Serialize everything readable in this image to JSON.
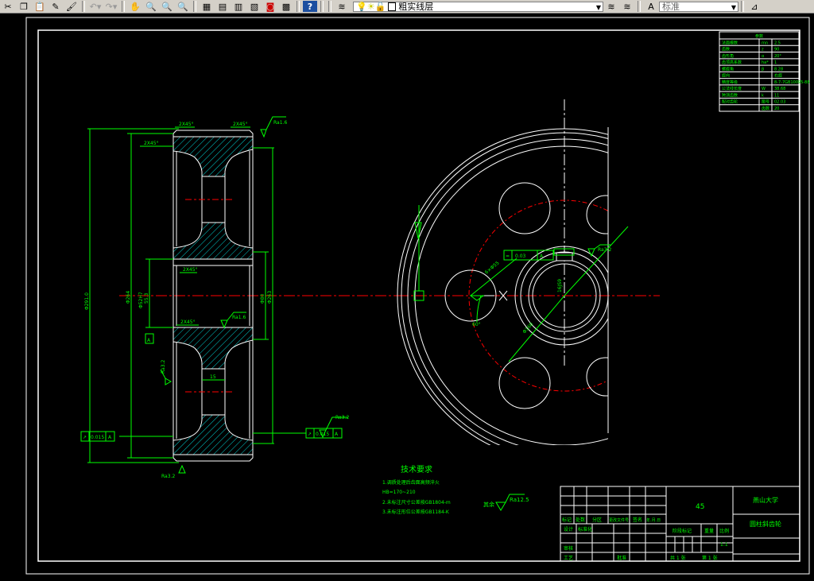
{
  "toolbar": {
    "icons": [
      "cut-icon",
      "copy-icon",
      "paste-icon",
      "match-properties-icon",
      "brush-icon",
      "undo-icon",
      "redo-icon",
      "pan-icon",
      "zoom-realtime-icon",
      "zoom-window-icon",
      "zoom-previous-icon",
      "properties-icon",
      "design-center-icon",
      "tool-palettes-icon",
      "sheet-set-icon",
      "markup-icon",
      "calculator-icon",
      "help-icon",
      "layer-manager-icon",
      "layer-state-icon",
      "layer-previous-icon",
      "text-style-icon",
      "dimension-style-icon"
    ],
    "layer_value": "粗实线层",
    "text_style_value": "标准",
    "help_label": "?"
  },
  "drawing": {
    "tech_req": {
      "title": "技术要求",
      "lines": [
        "1.调质处理后齿面高频淬火",
        "HB=170~210",
        "2.未标注尺寸公差按GB1804-m",
        "3.未标注形位公差按GB1184-K"
      ]
    },
    "other_roughness": "其余",
    "other_roughness_value": "Ra12.5",
    "left_view": {
      "chamfer_top_left": "2X45°",
      "chamfer_top_right": "2X45°",
      "chamfer_rim": "2X45°",
      "chamfer_bore_top": "2X45°",
      "chamfer_bore_bottom": "2X45°",
      "roughness_top": "Ra1.6",
      "roughness_bore": "Ra1.6",
      "roughness_bottom": "Ra3.2",
      "roughness_face": "Ra3.2",
      "roughness_side": "Ra3.2",
      "dim_tip": "Φ291.0",
      "dim_root": "Φ264",
      "dim_bore": "Φ52H7",
      "dim_keyway": "55.3",
      "dim_hub1": "Φ80",
      "dim_hub2": "Φ263",
      "dim_web": "15",
      "datum": "A",
      "tol_left": [
        "↗",
        "0.015",
        "A"
      ],
      "tol_right": [
        "↗",
        "0.015",
        "A"
      ]
    },
    "right_view": {
      "tol_keyway": [
        "=",
        "0.03",
        "A"
      ],
      "roughness_keyway": "Ra3.2",
      "dim_holes": "6×Φ55",
      "dim_bolt_circle": "Φ160",
      "dim_keyway_width": "16JS9",
      "dim_angle": "60°"
    },
    "param_table": {
      "title": "参数",
      "rows": [
        [
          "法面模数",
          "mn",
          "2.5"
        ],
        [
          "齿数",
          "z",
          "90"
        ],
        [
          "齿形角",
          "α",
          "20°"
        ],
        [
          "齿顶高系数",
          "ha*",
          "1"
        ],
        [
          "螺旋角",
          "β",
          "8.28"
        ],
        [
          "旋向",
          "",
          "右旋"
        ],
        [
          "精度等级",
          "",
          "8-7-7GB10095-88"
        ],
        [
          "公法线长度",
          "W",
          "38.68"
        ],
        [
          "跨测齿数",
          "k",
          "11"
        ],
        [
          "配对齿轮",
          "图号",
          "02.03"
        ],
        [
          "",
          "齿数",
          "20"
        ]
      ]
    },
    "title_block": {
      "material": "45",
      "school": "燕山大学",
      "part_name": "圆柱斜齿轮",
      "headers": [
        "标记",
        "处数",
        "分区",
        "更改文件号",
        "签名",
        "年.月.日"
      ],
      "row_design": [
        "设计",
        "标准化"
      ],
      "stage_label": "阶段标记",
      "weight_label": "重量",
      "scale_label": "比例",
      "scale_value": "1:1",
      "review": "审核",
      "process": "工艺",
      "approve": "批准",
      "sheets": "共 1 张",
      "sheet_no": "第 1 张"
    }
  },
  "colors": {
    "background": "#000000",
    "outline": "#ffffff",
    "dimension": "#00ff00",
    "centerline": "#ff0000",
    "hatch": "#00ffff",
    "toolbar": "#d4d0c8"
  }
}
